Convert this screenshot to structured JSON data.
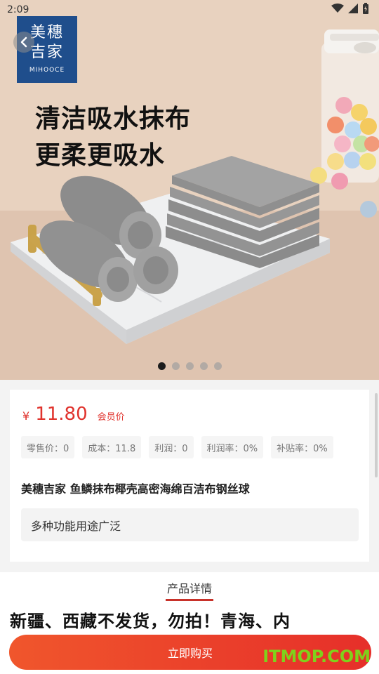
{
  "status_bar": {
    "time": "2:09"
  },
  "brand": {
    "line1": "美穗",
    "line2": "吉家",
    "english": "MIHOOCE"
  },
  "banner": {
    "headline_line1": "清洁吸水抹布",
    "headline_line2": "更柔更吸水",
    "carousel_count": 5,
    "carousel_active_index": 0
  },
  "price": {
    "symbol": "¥",
    "value": "11.80",
    "member_label": "会员价"
  },
  "stats": [
    {
      "label": "零售价：0"
    },
    {
      "label": "成本：11.8"
    },
    {
      "label": "利润：0"
    },
    {
      "label": "利润率：0%"
    },
    {
      "label": "补贴率：0%"
    }
  ],
  "product": {
    "title": "美穗吉家 鱼鳞抹布椰壳高密海绵百洁布钢丝球",
    "description": "多种功能用途广泛"
  },
  "detail": {
    "tab_label": "产品详情",
    "body_text": "新疆、西藏不发货，勿拍！青海、内"
  },
  "actions": {
    "buy_label": "立即购买"
  },
  "watermark": "ITMOP.COM",
  "colors": {
    "accent": "#e0322c",
    "brand_blue": "#1f4e8c",
    "watermark_green": "#7fd11b"
  }
}
